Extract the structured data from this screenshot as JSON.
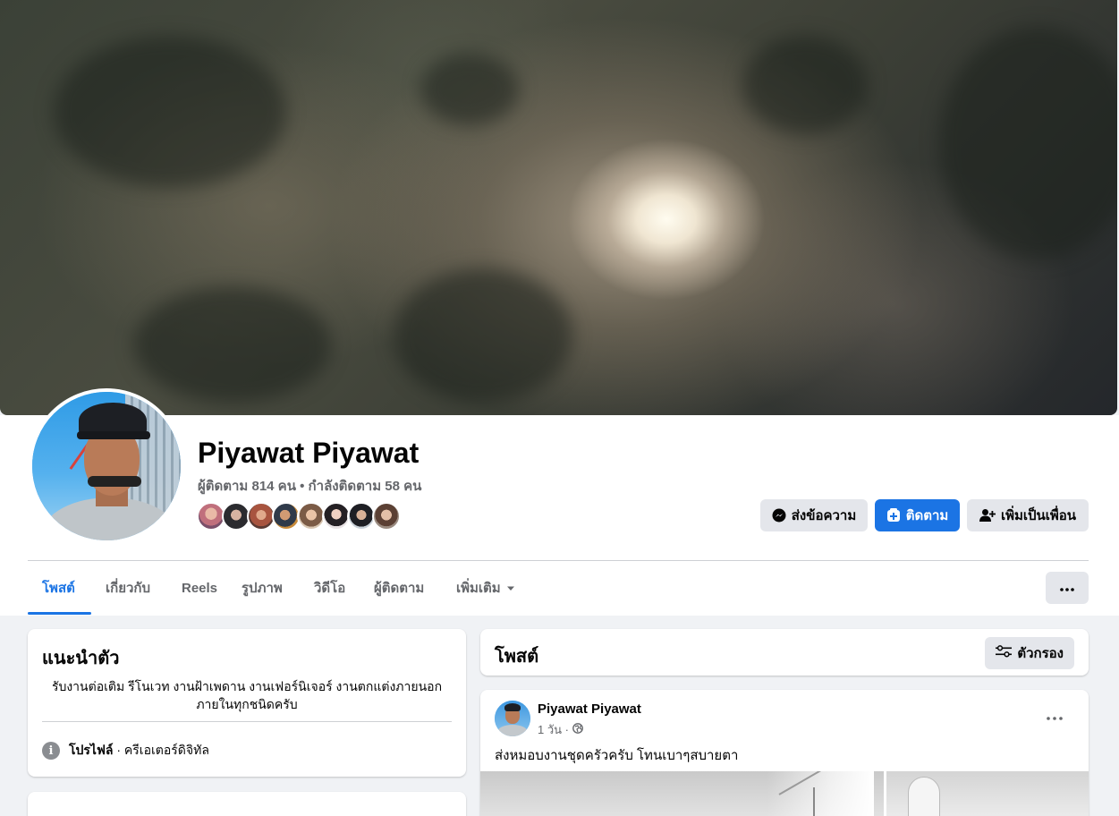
{
  "profile": {
    "name": "Piyawat Piyawat",
    "counts": "ผู้ติดตาม 814 คน • กำลังติดตาม 58 คน"
  },
  "actions": {
    "message": "ส่งข้อความ",
    "follow": "ติดตาม",
    "add_friend": "เพิ่มเป็นเพื่อน"
  },
  "tabs": [
    "โพสต์",
    "เกี่ยวกับ",
    "Reels",
    "รูปภาพ",
    "วิดีโอ",
    "ผู้ติดตาม",
    "เพิ่มเติม"
  ],
  "intro": {
    "title": "แนะนำตัว",
    "bio_line1": "รับงานต่อเติม รีโนเวท งานฝ้าเพดาน งานเฟอร์นิเจอร์ งานตกแต่งภายนอก",
    "bio_line2": "ภายในทุกชนิดครับ",
    "profile_label": "โปรไฟล์",
    "profile_sep": " · ",
    "profile_value": "ครีเอเตอร์ดิจิทัล"
  },
  "posts": {
    "title": "โพสต์",
    "filter_label": "ตัวกรอง",
    "items": [
      {
        "author": "Piyawat Piyawat",
        "time": "1 วัน ·",
        "text": "ส่งหมอบงานชุดครัวครับ  โทนเบาๆสบายตา"
      }
    ]
  },
  "colors": {
    "accent": "#1b74e4",
    "page_bg": "#f0f2f5",
    "secondary_text": "#65676b"
  }
}
